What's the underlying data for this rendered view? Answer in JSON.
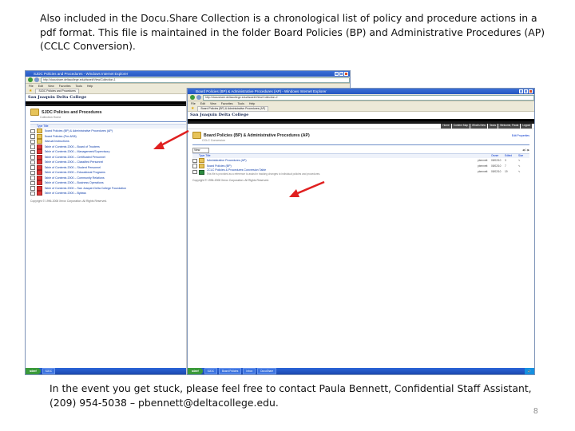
{
  "slide": {
    "top_text": "Also included in the Docu.Share Collection is a chronological list of policy and procedure actions in a pdf format.  This file is maintained in the folder Board Policies (BP) and Administrative Procedures (AP) (CCLC Conversion).",
    "bottom_text": "In the event you get stuck, please feel free to contact Paula Bennett, Confidential Staff Assistant, (209) 954-5038 – pbennett@deltacollege.edu.",
    "page_number": "8"
  },
  "back_window": {
    "title": "SJDC Policies and Procedures - Windows Internet Explorer",
    "url": "http://docushare.deltacollege.edu/dsweb/View/Collection-1",
    "menu": [
      "File",
      "Edit",
      "View",
      "Favorites",
      "Tools",
      "Help"
    ],
    "fav_tab": "SJDC Policies and Procedures",
    "banner": "San Joaquin Delta College",
    "collection_title": "SJDC Policies and Procedures",
    "collection_sub": "Collection Home",
    "type_header": "Type Title",
    "rows": [
      "Board Policies (BP) & Administrative Procedures (AP)",
      "Board Policies (Pre-8/08)",
      "Manual Instructions",
      "Table of Contents 2000 – Board of Trustees",
      "Table of Contents 2000 – Management/Supervisory",
      "Table of Contents 2000 – Certificated Personnel",
      "Table of Contents 2000 – Classified Personnel",
      "Table of Contents 2000 – Student Personnel",
      "Table of Contents 2000 – Educational Programs",
      "Table of Contents 2000 – Community Relations",
      "Table of Contents 2000 – Business Operations",
      "Table of Contents 2000 – San Joaquin Delta College Foundation",
      "Table of Contents 2000 – Bylaws"
    ],
    "footer": "Copyright © 1996-2008 Xerox Corporation. All Rights Reserved.",
    "taskbar": [
      "start",
      "SJDC",
      "Internet"
    ]
  },
  "front_window": {
    "title": "Board Policies (BP) & Administrative Procedures (AP) - Windows Internet Explorer",
    "url": "http://docushare.deltacollege.edu/dsweb/View/Collection-2",
    "menu": [
      "File",
      "Edit",
      "View",
      "Favorites",
      "Tools",
      "Help"
    ],
    "fav_tab": "Board Policies (BP) & Administrative Procedures (AP)",
    "banner": "San Joaquin Delta College",
    "nav_tabs": [
      "Home",
      "Content Map",
      "What's New",
      "Tasks",
      "Welcome, Paula",
      "Logout"
    ],
    "collection_title": "Board Policies (BP) & Administrative Procedures (AP)",
    "collection_sub": "CCLC Conversion",
    "edit_props": "Edit Properties",
    "view_select": "View",
    "type_header": "Type Title",
    "col_owner": "Owner",
    "col_edited": "Edited",
    "col_size": "Size",
    "rows": [
      {
        "name": "Administrative Procedures (AP)",
        "owner": "pbennett",
        "edited": "05/02/10",
        "size": "3"
      },
      {
        "name": "Board Policies (BP)",
        "owner": "pbennett",
        "edited": "05/02/10",
        "size": "7"
      },
      {
        "name": "CCLC Policies & Procedures Conversion Table",
        "sub": "This file is provided as a reference to assist in tracking changes to individual policies and procedures.",
        "owner": "pbennett",
        "edited": "05/02/10",
        "size": "19"
      }
    ],
    "footer": "Copyright © 1996-2008 Xerox Corporation. All Rights Reserved.",
    "taskbar": [
      "start",
      "SJDC",
      "Board Policies",
      "Inbox",
      "DocuShare"
    ]
  },
  "colors": {
    "accent": "#e02020",
    "xp_blue": "#2557c2"
  }
}
